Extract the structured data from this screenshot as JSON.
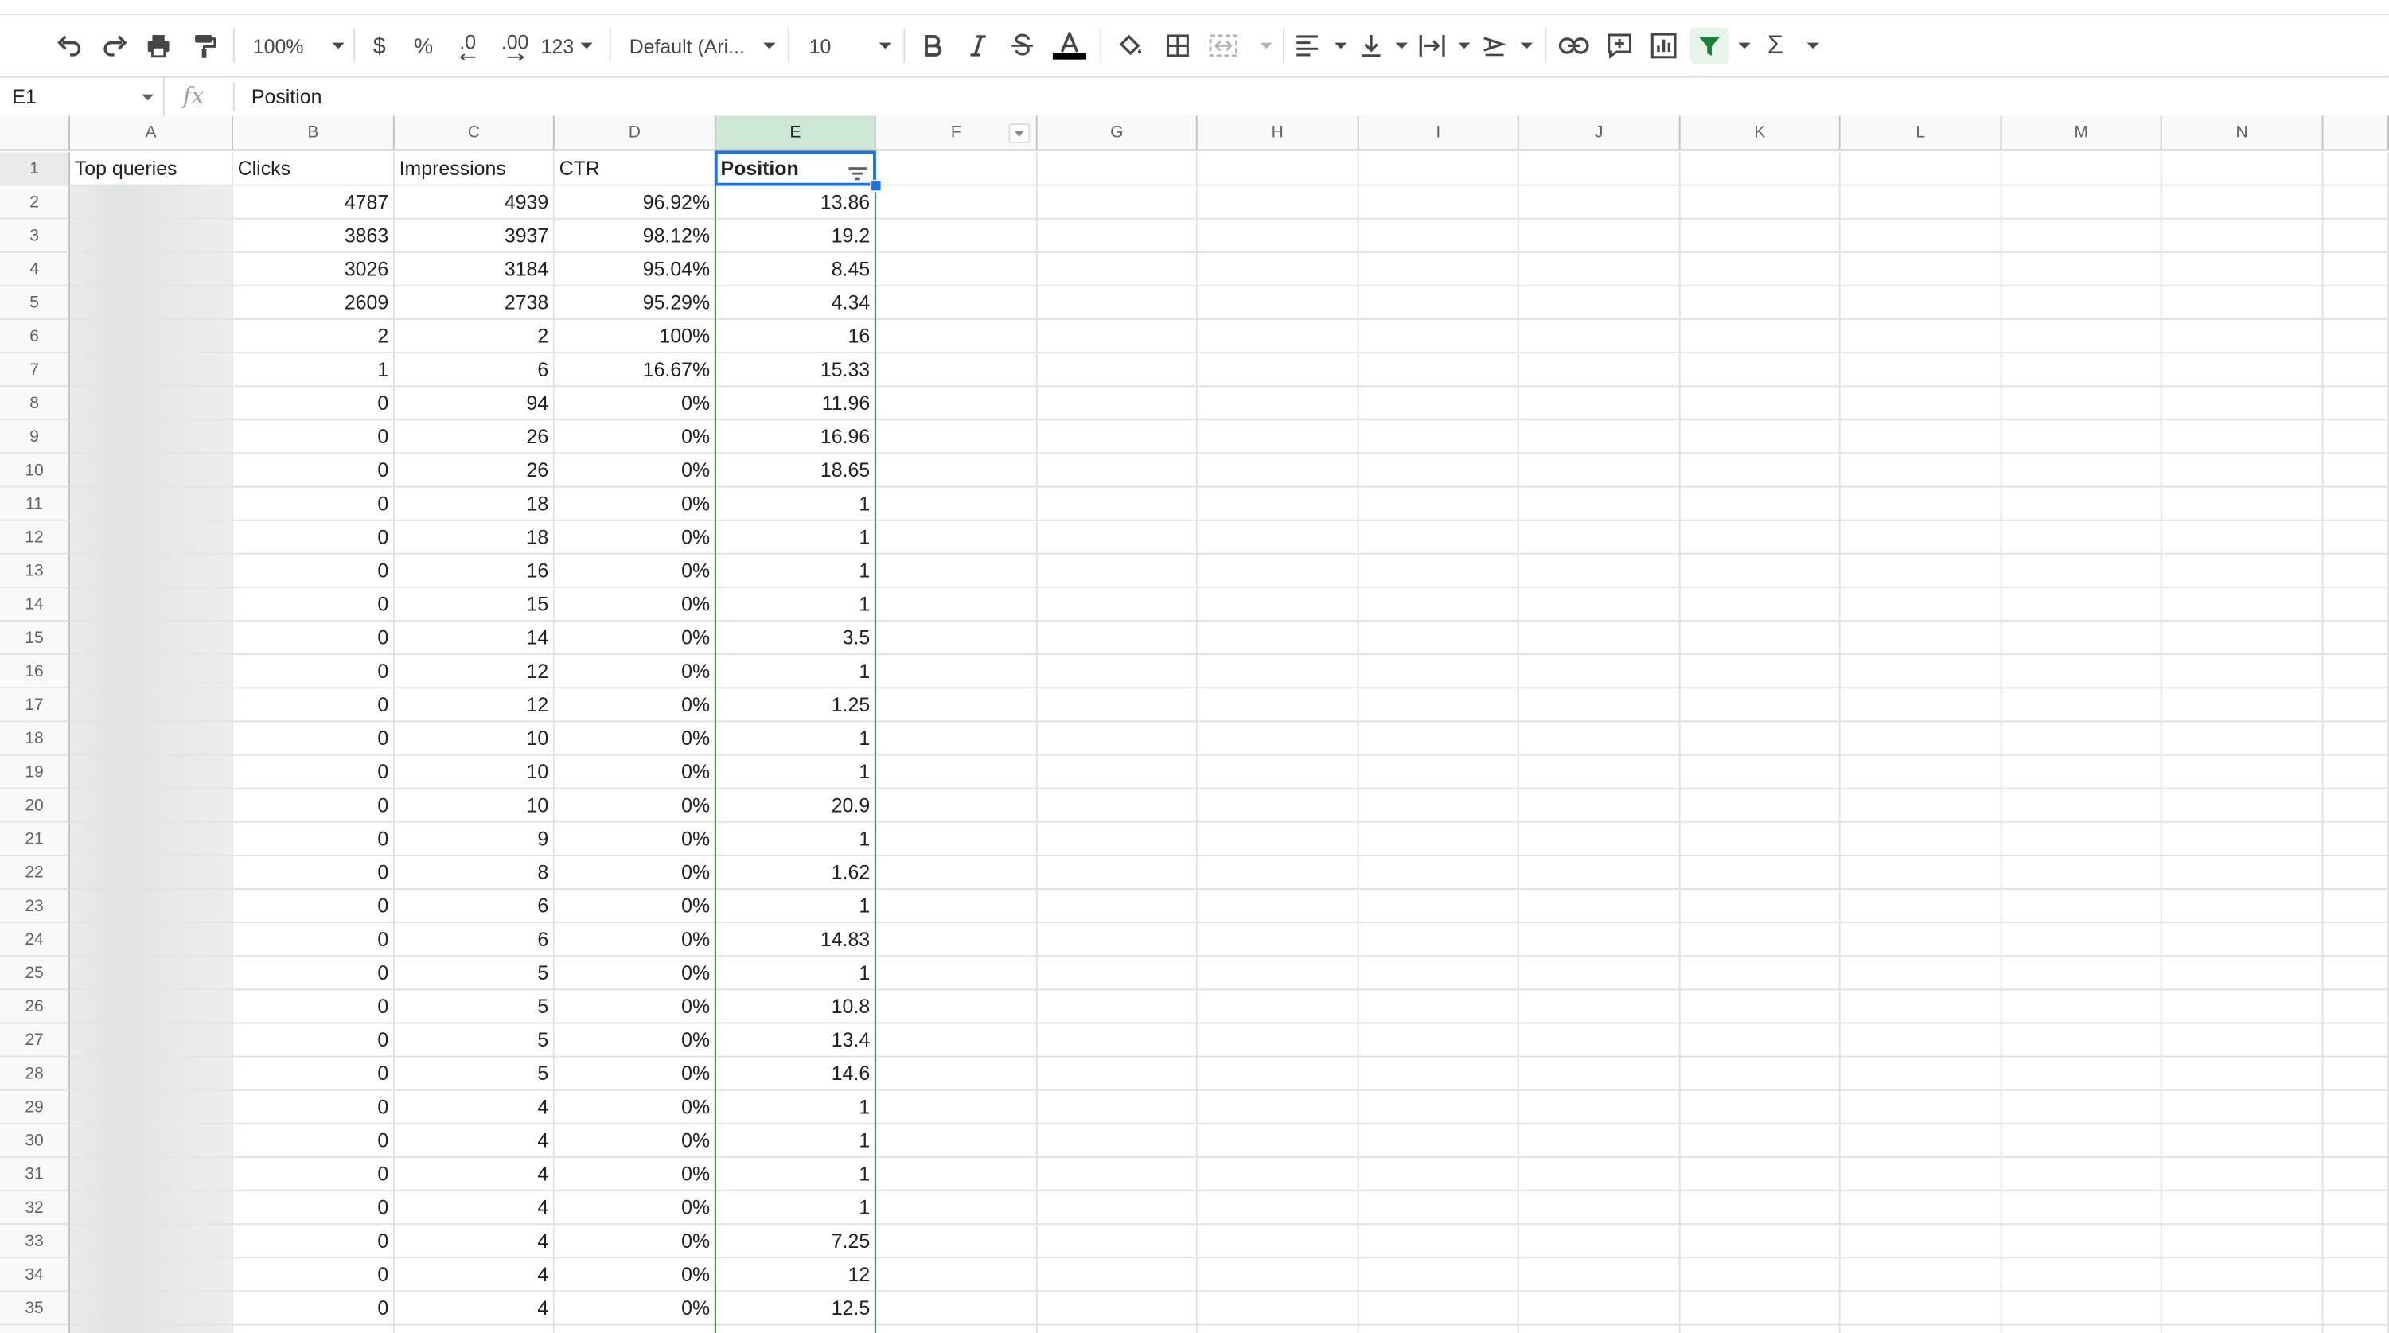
{
  "toolbar": {
    "zoom": "100%",
    "currency": "$",
    "percent": "%",
    "dec_decrease": ".0",
    "dec_increase": ".00",
    "more_formats": "123",
    "font": "Default (Ari...",
    "font_size": "10",
    "colors": {
      "text_color_bar": "#000000",
      "filter_active": "#188038"
    }
  },
  "formula_bar": {
    "cell_ref": "E1",
    "fx": "fx",
    "content": "Position"
  },
  "columns": [
    "A",
    "B",
    "C",
    "D",
    "E",
    "F",
    "G",
    "H",
    "I",
    "J",
    "K",
    "L",
    "M",
    "N"
  ],
  "selected_column": "E",
  "headers": [
    "Top queries",
    "Clicks",
    "Impressions",
    "CTR",
    "Position"
  ],
  "rows": [
    {
      "n": "2",
      "clicks": "4787",
      "impr": "4939",
      "ctr": "96.92%",
      "pos": "13.86"
    },
    {
      "n": "3",
      "clicks": "3863",
      "impr": "3937",
      "ctr": "98.12%",
      "pos": "19.2"
    },
    {
      "n": "4",
      "clicks": "3026",
      "impr": "3184",
      "ctr": "95.04%",
      "pos": "8.45"
    },
    {
      "n": "5",
      "clicks": "2609",
      "impr": "2738",
      "ctr": "95.29%",
      "pos": "4.34"
    },
    {
      "n": "6",
      "clicks": "2",
      "impr": "2",
      "ctr": "100%",
      "pos": "16"
    },
    {
      "n": "7",
      "clicks": "1",
      "impr": "6",
      "ctr": "16.67%",
      "pos": "15.33"
    },
    {
      "n": "8",
      "clicks": "0",
      "impr": "94",
      "ctr": "0%",
      "pos": "11.96"
    },
    {
      "n": "9",
      "clicks": "0",
      "impr": "26",
      "ctr": "0%",
      "pos": "16.96"
    },
    {
      "n": "10",
      "clicks": "0",
      "impr": "26",
      "ctr": "0%",
      "pos": "18.65"
    },
    {
      "n": "11",
      "clicks": "0",
      "impr": "18",
      "ctr": "0%",
      "pos": "1"
    },
    {
      "n": "12",
      "clicks": "0",
      "impr": "18",
      "ctr": "0%",
      "pos": "1"
    },
    {
      "n": "13",
      "clicks": "0",
      "impr": "16",
      "ctr": "0%",
      "pos": "1"
    },
    {
      "n": "14",
      "clicks": "0",
      "impr": "15",
      "ctr": "0%",
      "pos": "1"
    },
    {
      "n": "15",
      "clicks": "0",
      "impr": "14",
      "ctr": "0%",
      "pos": "3.5"
    },
    {
      "n": "16",
      "clicks": "0",
      "impr": "12",
      "ctr": "0%",
      "pos": "1"
    },
    {
      "n": "17",
      "clicks": "0",
      "impr": "12",
      "ctr": "0%",
      "pos": "1.25"
    },
    {
      "n": "18",
      "clicks": "0",
      "impr": "10",
      "ctr": "0%",
      "pos": "1"
    },
    {
      "n": "19",
      "clicks": "0",
      "impr": "10",
      "ctr": "0%",
      "pos": "1"
    },
    {
      "n": "20",
      "clicks": "0",
      "impr": "10",
      "ctr": "0%",
      "pos": "20.9"
    },
    {
      "n": "21",
      "clicks": "0",
      "impr": "9",
      "ctr": "0%",
      "pos": "1"
    },
    {
      "n": "22",
      "clicks": "0",
      "impr": "8",
      "ctr": "0%",
      "pos": "1.62"
    },
    {
      "n": "23",
      "clicks": "0",
      "impr": "6",
      "ctr": "0%",
      "pos": "1"
    },
    {
      "n": "24",
      "clicks": "0",
      "impr": "6",
      "ctr": "0%",
      "pos": "14.83"
    },
    {
      "n": "25",
      "clicks": "0",
      "impr": "5",
      "ctr": "0%",
      "pos": "1"
    },
    {
      "n": "26",
      "clicks": "0",
      "impr": "5",
      "ctr": "0%",
      "pos": "10.8"
    },
    {
      "n": "27",
      "clicks": "0",
      "impr": "5",
      "ctr": "0%",
      "pos": "13.4"
    },
    {
      "n": "28",
      "clicks": "0",
      "impr": "5",
      "ctr": "0%",
      "pos": "14.6"
    },
    {
      "n": "29",
      "clicks": "0",
      "impr": "4",
      "ctr": "0%",
      "pos": "1"
    },
    {
      "n": "30",
      "clicks": "0",
      "impr": "4",
      "ctr": "0%",
      "pos": "1"
    },
    {
      "n": "31",
      "clicks": "0",
      "impr": "4",
      "ctr": "0%",
      "pos": "1"
    },
    {
      "n": "32",
      "clicks": "0",
      "impr": "4",
      "ctr": "0%",
      "pos": "1"
    },
    {
      "n": "33",
      "clicks": "0",
      "impr": "4",
      "ctr": "0%",
      "pos": "7.25"
    },
    {
      "n": "34",
      "clicks": "0",
      "impr": "4",
      "ctr": "0%",
      "pos": "12"
    },
    {
      "n": "35",
      "clicks": "0",
      "impr": "4",
      "ctr": "0%",
      "pos": "12.5"
    }
  ]
}
